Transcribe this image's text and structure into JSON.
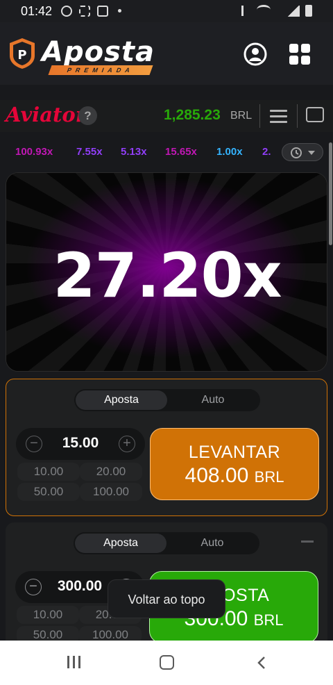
{
  "status_bar": {
    "time": "01:42"
  },
  "site": {
    "brand": "Aposta",
    "brand_sub": "PREMIADA"
  },
  "game": {
    "name": "Aviator",
    "help_label": "?",
    "balance": "1,285.23",
    "currency": "BRL",
    "current_multiplier": "27.20x"
  },
  "history": {
    "items": [
      {
        "value": "100.93x",
        "color": "#c017b4"
      },
      {
        "value": "7.55x",
        "color": "#913ef8"
      },
      {
        "value": "5.13x",
        "color": "#913ef8"
      },
      {
        "value": "15.65x",
        "color": "#c017b4"
      },
      {
        "value": "1.00x",
        "color": "#34b4ff"
      },
      {
        "value": "2.",
        "color": "#913ef8"
      }
    ]
  },
  "bet_panel_1": {
    "tabs": [
      "Aposta",
      "Auto"
    ],
    "stake": "15.00",
    "quick_amounts": [
      "10.00",
      "20.00",
      "50.00",
      "100.00"
    ],
    "action_label": "LEVANTAR",
    "action_amount": "408.00",
    "action_currency": "BRL"
  },
  "bet_panel_2": {
    "tabs": [
      "Aposta",
      "Auto"
    ],
    "stake": "300.00",
    "quick_amounts": [
      "10.00",
      "20.00",
      "50.00",
      "100.00"
    ],
    "action_label": "APOSTA",
    "action_amount": "300.00",
    "action_currency": "BRL"
  },
  "toast": {
    "text": "Voltar ao topo"
  },
  "colors": {
    "accent_orange": "#d07206",
    "accent_green": "#28a909",
    "brand_red": "#e50539"
  },
  "icons": [
    "user-icon",
    "grid-icon",
    "menu-icon",
    "chat-icon",
    "history-icon",
    "minus-icon",
    "plus-icon",
    "nav-recents-icon",
    "nav-home-icon",
    "nav-back-icon"
  ]
}
